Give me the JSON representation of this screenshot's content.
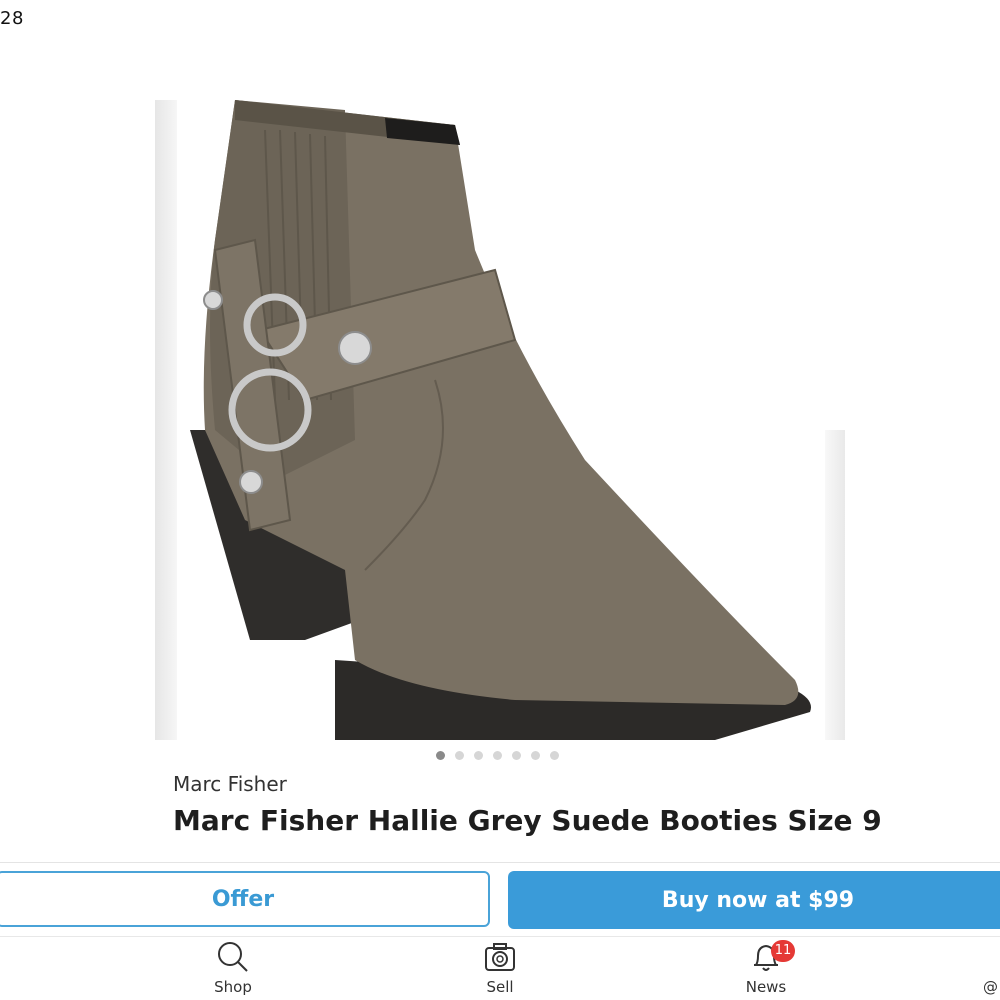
{
  "status_bar": {
    "time": "28"
  },
  "product": {
    "image_icon": "boot-photo",
    "carousel_count": 7,
    "carousel_active_index": 0,
    "brand": "Marc Fisher",
    "title": "Marc Fisher Hallie Grey Suede Booties Size 9"
  },
  "actions": {
    "offer_label": "Offer",
    "buy_label": "Buy now at $99",
    "accent_color": "#3a9bd9"
  },
  "tabbar": {
    "items": [
      {
        "label": "Shop",
        "icon": "search-icon"
      },
      {
        "label": "Sell",
        "icon": "camera-icon"
      },
      {
        "label": "News",
        "icon": "bell-icon",
        "badge": "11"
      }
    ],
    "partial_glyph": "@"
  }
}
